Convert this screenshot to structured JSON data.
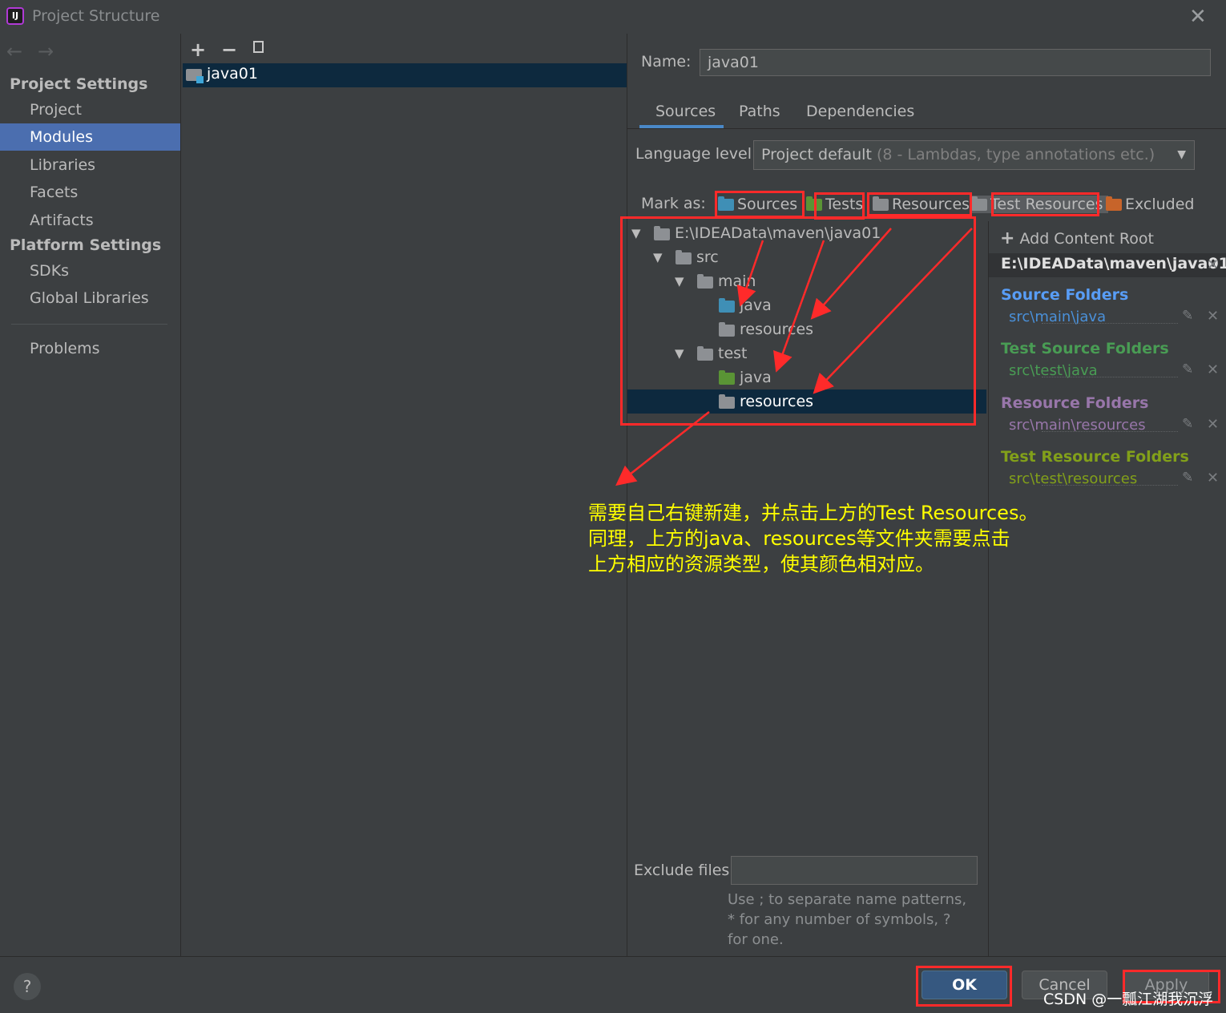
{
  "window": {
    "title": "Project Structure",
    "logo_text": "IJ"
  },
  "sidebar": {
    "sections": [
      {
        "title": "Project Settings",
        "items": [
          "Project",
          "Modules",
          "Libraries",
          "Facets",
          "Artifacts"
        ]
      },
      {
        "title": "Platform Settings",
        "items": [
          "SDKs",
          "Global Libraries"
        ]
      }
    ],
    "selected": "Modules",
    "problems": "Problems"
  },
  "modules": {
    "items": [
      "java01"
    ]
  },
  "module": {
    "name_label": "Name:",
    "name_value": "java01",
    "tabs": [
      "Sources",
      "Paths",
      "Dependencies"
    ],
    "active_tab": "Sources",
    "language_label": "Language level:",
    "language_value": "Project default",
    "language_hint": "(8 - Lambdas, type annotations etc.)",
    "mark_as_label": "Mark as:",
    "mark_as": [
      {
        "label": "Sources",
        "color": "#3f8fb6"
      },
      {
        "label": "Tests",
        "color": "#5a9435"
      },
      {
        "label": "Resources",
        "color": "#8a8d90"
      },
      {
        "label": "Test Resources",
        "color": "#8a8d90"
      },
      {
        "label": "Excluded",
        "color": "#c7642a"
      }
    ],
    "tree": [
      {
        "label": "E:\\IDEAData\\maven\\java01",
        "icon": "folder-icon",
        "color": "#8d9094"
      },
      {
        "label": "src",
        "icon": "folder-icon",
        "color": "#8d9094"
      },
      {
        "label": "main",
        "icon": "folder-icon",
        "color": "#8d9094"
      },
      {
        "label": "java",
        "icon": "source-folder-icon",
        "color": "#3f8fb6"
      },
      {
        "label": "resources",
        "icon": "resources-folder-icon",
        "color": "#8d9094"
      },
      {
        "label": "test",
        "icon": "folder-icon",
        "color": "#8d9094"
      },
      {
        "label": "java",
        "icon": "test-folder-icon",
        "color": "#5a9435"
      },
      {
        "label": "resources",
        "icon": "test-resources-folder-icon",
        "color": "#8d9094"
      }
    ],
    "exclude_label": "Exclude files:",
    "exclude_value": "",
    "exclude_help": "Use ; to separate name patterns, * for any number of symbols, ? for one."
  },
  "content_root": {
    "add_label": "Add Content Root",
    "path": "E:\\IDEAData\\maven\\java01",
    "groups": [
      {
        "title": "Source Folders",
        "path": "src\\main\\java",
        "color": "#589df6",
        "path_color": "#4a90d9"
      },
      {
        "title": "Test Source Folders",
        "path": "src\\test\\java",
        "color": "#499c54",
        "path_color": "#499c54"
      },
      {
        "title": "Resource Folders",
        "path": "src\\main\\resources",
        "color": "#9876aa",
        "path_color": "#9876aa"
      },
      {
        "title": "Test Resource Folders",
        "path": "src\\test\\resources",
        "color": "#82a01a",
        "path_color": "#82a01a"
      }
    ]
  },
  "buttons": {
    "ok": "OK",
    "cancel": "Cancel",
    "apply": "Apply",
    "help": "?"
  },
  "annotation": {
    "lines": [
      "需要自己右键新建，并点击上方的Test Resources。",
      "同理，上方的java、resources等文件夹需要点击",
      "上方相应的资源类型，使其颜色相对应。"
    ],
    "color": "#ffff00",
    "box_color": "#ff2a2a"
  },
  "watermark": "CSDN @一瓢江湖我沉浮"
}
